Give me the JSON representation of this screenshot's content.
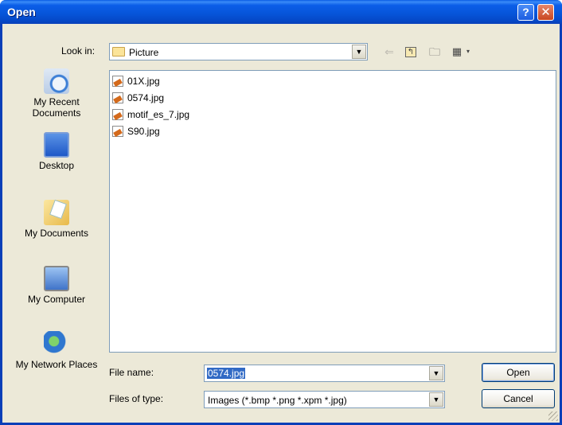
{
  "window": {
    "title": "Open",
    "help_label": "?",
    "close_label": "✕"
  },
  "toolbar": {
    "lookin_label": "Look in:",
    "lookin_value": "Picture",
    "back_glyph": "⇐",
    "view_glyph": "▦",
    "view_caret": "▾"
  },
  "places": [
    {
      "label": "My Recent Documents",
      "icon": "recent-documents-icon"
    },
    {
      "label": "Desktop",
      "icon": "desktop-icon"
    },
    {
      "label": "My Documents",
      "icon": "my-documents-icon"
    },
    {
      "label": "My Computer",
      "icon": "my-computer-icon"
    },
    {
      "label": "My Network Places",
      "icon": "network-places-icon"
    }
  ],
  "files": [
    {
      "name": "01X.jpg"
    },
    {
      "name": "0574.jpg"
    },
    {
      "name": "motif_es_7.jpg"
    },
    {
      "name": "S90.jpg"
    }
  ],
  "form": {
    "filename_label": "File name:",
    "filename_value": "0574.jpg",
    "filetype_label": "Files of type:",
    "filetype_value": "Images (*.bmp *.png *.xpm *.jpg)"
  },
  "buttons": {
    "open": "Open",
    "cancel": "Cancel"
  },
  "colors": {
    "titlebar": "#0654d8",
    "selection": "#316ac5",
    "dialog_bg": "#ece9d8"
  }
}
